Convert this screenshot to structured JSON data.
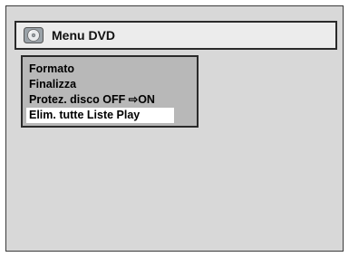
{
  "menu": {
    "title": "Menu DVD",
    "title_icon": "disc-icon",
    "items": [
      {
        "label": "Formato"
      },
      {
        "label": "Finalizza"
      },
      {
        "label": "Protez. disco OFF ⇨ON"
      },
      {
        "label": "Elim. tutte Liste Play",
        "selected": true
      }
    ]
  },
  "colors": {
    "screen_bg": "#d8d8d8",
    "panel_bg": "#b8b8b8",
    "title_bg": "#ececec",
    "selected_bg": "#ffffff"
  }
}
